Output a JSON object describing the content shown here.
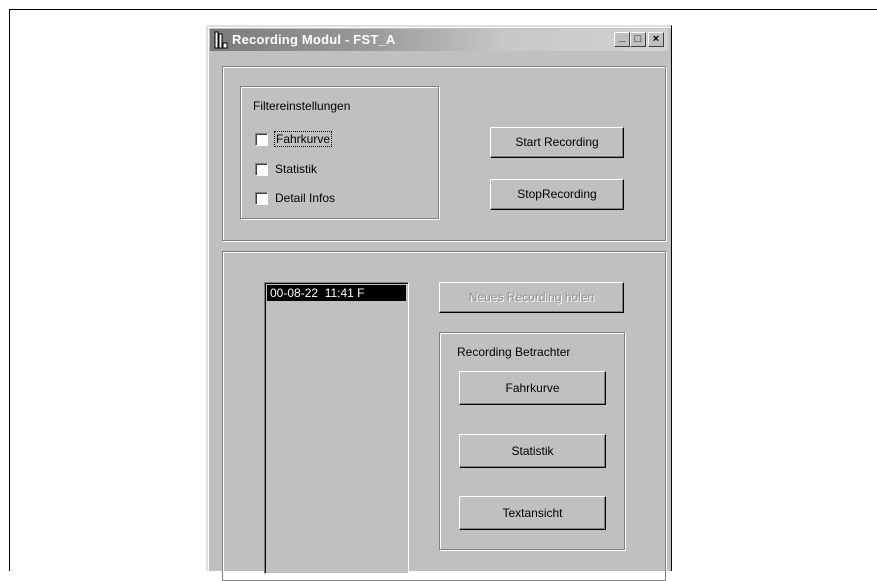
{
  "window": {
    "title": "Recording Modul - FST_A",
    "controls": {
      "minimize": "_",
      "maximize": "□",
      "close": "×"
    }
  },
  "filter_group": {
    "caption": "Filtereinstellungen",
    "checkboxes": [
      {
        "label": "Fahrkurve",
        "checked": false,
        "focused": true
      },
      {
        "label": "Statistik",
        "checked": false,
        "focused": false
      },
      {
        "label": "Detail Infos",
        "checked": false,
        "focused": false
      }
    ]
  },
  "recording_buttons": {
    "start": "Start Recording",
    "stop": "StopRecording"
  },
  "recordings_list": {
    "items": [
      "00-08-22  11:41 F"
    ],
    "selected_index": 0
  },
  "fetch_button": {
    "label": "Neues Recording holen",
    "enabled": false
  },
  "viewer_group": {
    "caption": "Recording Betrachter",
    "buttons": [
      "Fahrkurve",
      "Statistik",
      "Textansicht"
    ]
  },
  "colors": {
    "face": "#c0c0c0",
    "selection": "#000000"
  }
}
